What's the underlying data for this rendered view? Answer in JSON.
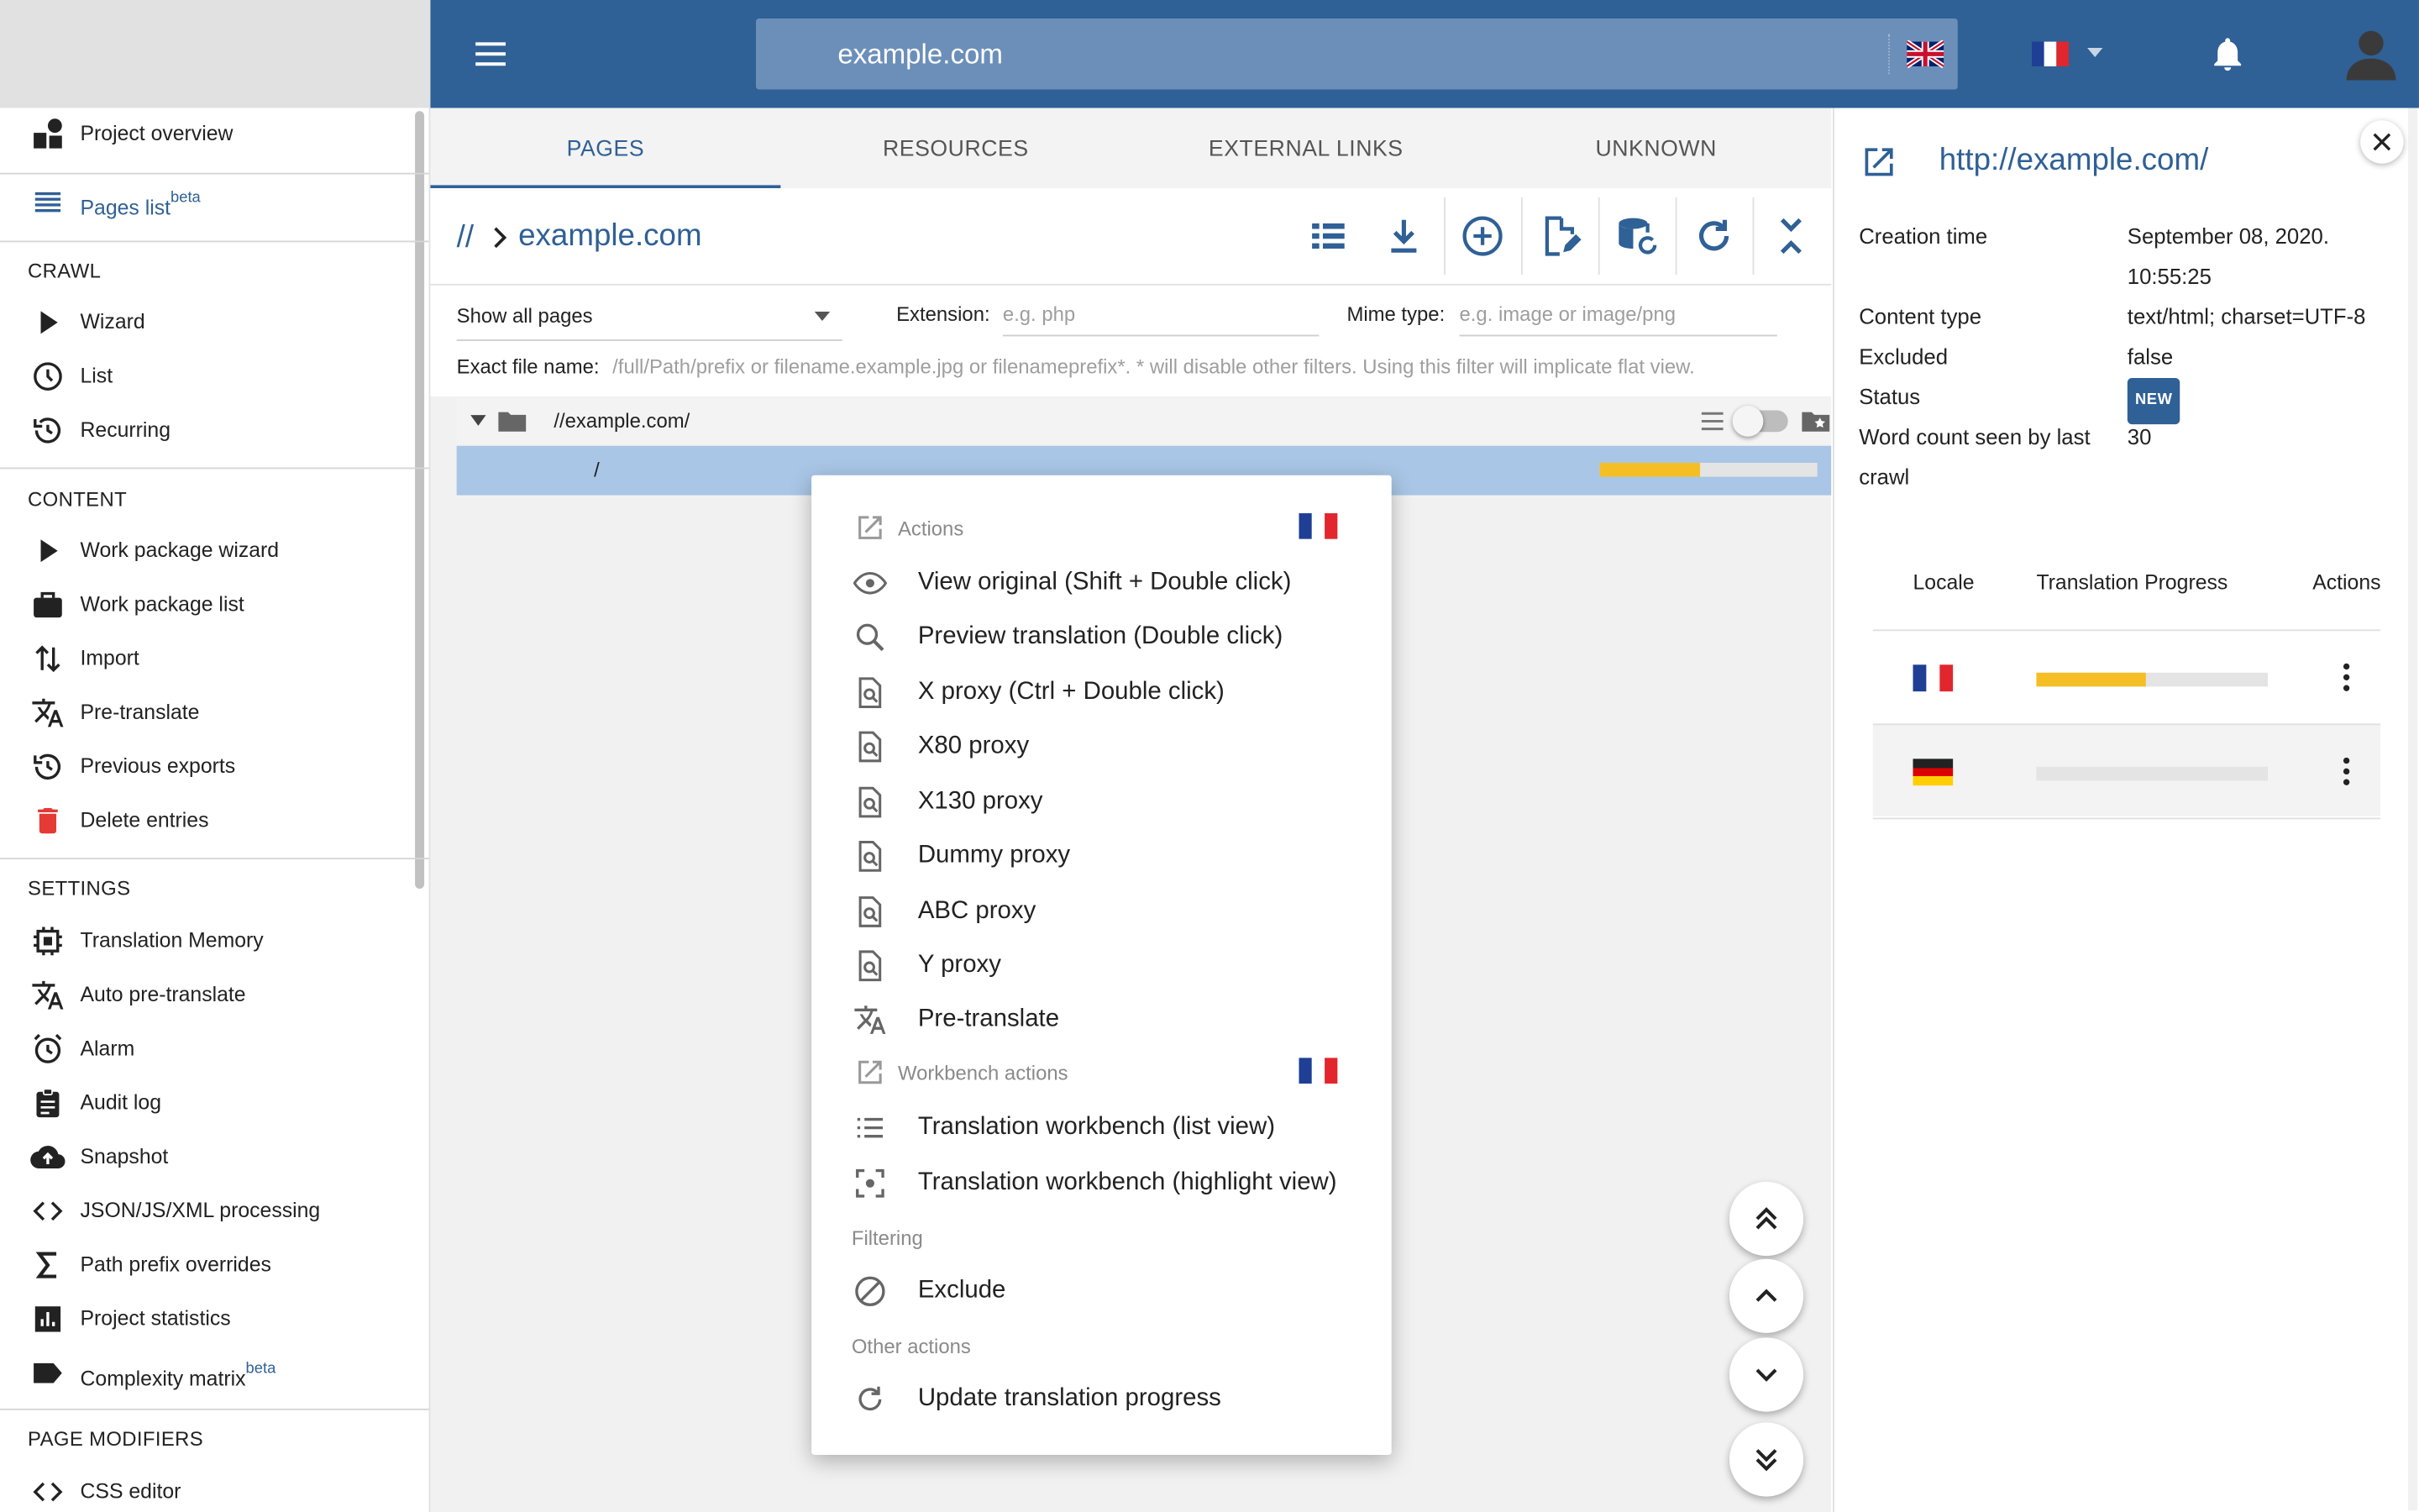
{
  "colors": {
    "topbar": "#2f6096",
    "accent": "#2f6096",
    "selection_row": "#a9c6e6",
    "progress": "#f5be25",
    "delete_red": "#e53935"
  },
  "header": {
    "search_value": "example.com",
    "search_flag": "flag-uk-icon",
    "language_flag": "flag-fr-icon"
  },
  "sidebar": {
    "project_overview": "Project overview",
    "pages_list": "Pages list",
    "pages_list_badge": "beta",
    "crawl_heading": "CRAWL",
    "wizard": "Wizard",
    "list": "List",
    "recurring": "Recurring",
    "content_heading": "CONTENT",
    "work_package_wizard": "Work package wizard",
    "work_package_list": "Work package list",
    "import": "Import",
    "pre_translate": "Pre-translate",
    "previous_exports": "Previous exports",
    "delete_entries": "Delete entries",
    "settings_heading": "SETTINGS",
    "translation_memory": "Translation Memory",
    "auto_pre_translate": "Auto pre-translate",
    "alarm": "Alarm",
    "audit_log": "Audit log",
    "snapshot": "Snapshot",
    "json_processing": "JSON/JS/XML processing",
    "path_prefix_overrides": "Path prefix overrides",
    "project_statistics": "Project statistics",
    "complexity_matrix": "Complexity matrix",
    "complexity_matrix_badge": "beta",
    "page_modifiers_heading": "PAGE MODIFIERS",
    "css_editor": "CSS editor"
  },
  "tabs": {
    "pages": "PAGES",
    "resources": "RESOURCES",
    "external_links": "EXTERNAL LINKS",
    "unknown": "UNKNOWN",
    "active": "PAGES"
  },
  "breadcrumb": {
    "root": "//",
    "current": "example.com"
  },
  "filters": {
    "show_value": "Show all pages",
    "extension_label": "Extension:",
    "extension_placeholder": "e.g. php",
    "mime_label": "Mime type:",
    "mime_placeholder": "e.g. image or image/png",
    "exact_label": "Exact file name:",
    "exact_placeholder": "/full/Path/prefix or filename.example.jpg or filenameprefix*. * will disable other filters. Using this filter will implicate flat view."
  },
  "tree": {
    "root_path": "//example.com/",
    "page_path": "/",
    "page_progress": 0.46
  },
  "context_menu": {
    "actions_heading": "Actions",
    "view_original": "View original (Shift + Double click)",
    "preview_translation": "Preview translation (Double click)",
    "x_proxy": "X proxy (Ctrl + Double click)",
    "x80_proxy": "X80 proxy",
    "x130_proxy": "X130 proxy",
    "dummy_proxy": "Dummy proxy",
    "abc_proxy": "ABC proxy",
    "y_proxy": "Y proxy",
    "pre_translate": "Pre-translate",
    "workbench_heading": "Workbench actions",
    "workbench_list": "Translation workbench (list view)",
    "workbench_highlight": "Translation workbench (highlight view)",
    "filtering_heading": "Filtering",
    "exclude": "Exclude",
    "other_heading": "Other actions",
    "update_progress": "Update translation progress"
  },
  "panel": {
    "url": "http://example.com/",
    "creation_time_label": "Creation time",
    "creation_time_value_1": "September 08, 2020.",
    "creation_time_value_2": "10:55:25",
    "content_type_label": "Content type",
    "content_type_value": "text/html; charset=UTF-8",
    "excluded_label": "Excluded",
    "excluded_value": "false",
    "status_label": "Status",
    "status_value": "NEW",
    "word_count_label_1": "Word count seen by last",
    "word_count_label_2": "crawl",
    "word_count_value": "30",
    "table": {
      "col_locale": "Locale",
      "col_progress": "Translation Progress",
      "col_actions": "Actions",
      "rows": [
        {
          "locale_icon": "flag-fr-icon",
          "progress": 0.47
        },
        {
          "locale_icon": "flag-de-icon",
          "progress": 0
        }
      ]
    }
  }
}
